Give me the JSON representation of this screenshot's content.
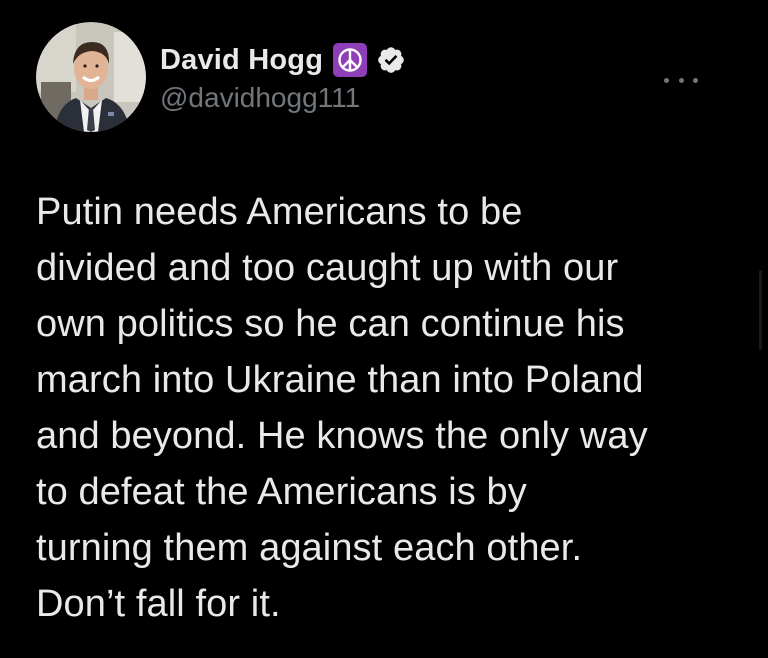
{
  "tweet": {
    "author": {
      "display_name": "David Hogg",
      "handle": "@davidhogg111",
      "badges": [
        "peace-symbol-icon",
        "verified-check-icon"
      ],
      "badge_colors": {
        "peace": "#8e3fb8",
        "verified": "#e7e9ea"
      }
    },
    "text": "Putin needs Americans to be\ndivided and too caught up with our\nown politics so he can continue his\nmarch into Ukraine than into Poland\nand beyond. He knows the only way\nto defeat the Americans is by\nturning them against each other.\nDon’t fall for it.",
    "more_icon": "more-horizontal-icon"
  },
  "theme": {
    "background": "#000000",
    "primary_text": "#e7e9ea",
    "secondary_text": "#71767b"
  }
}
